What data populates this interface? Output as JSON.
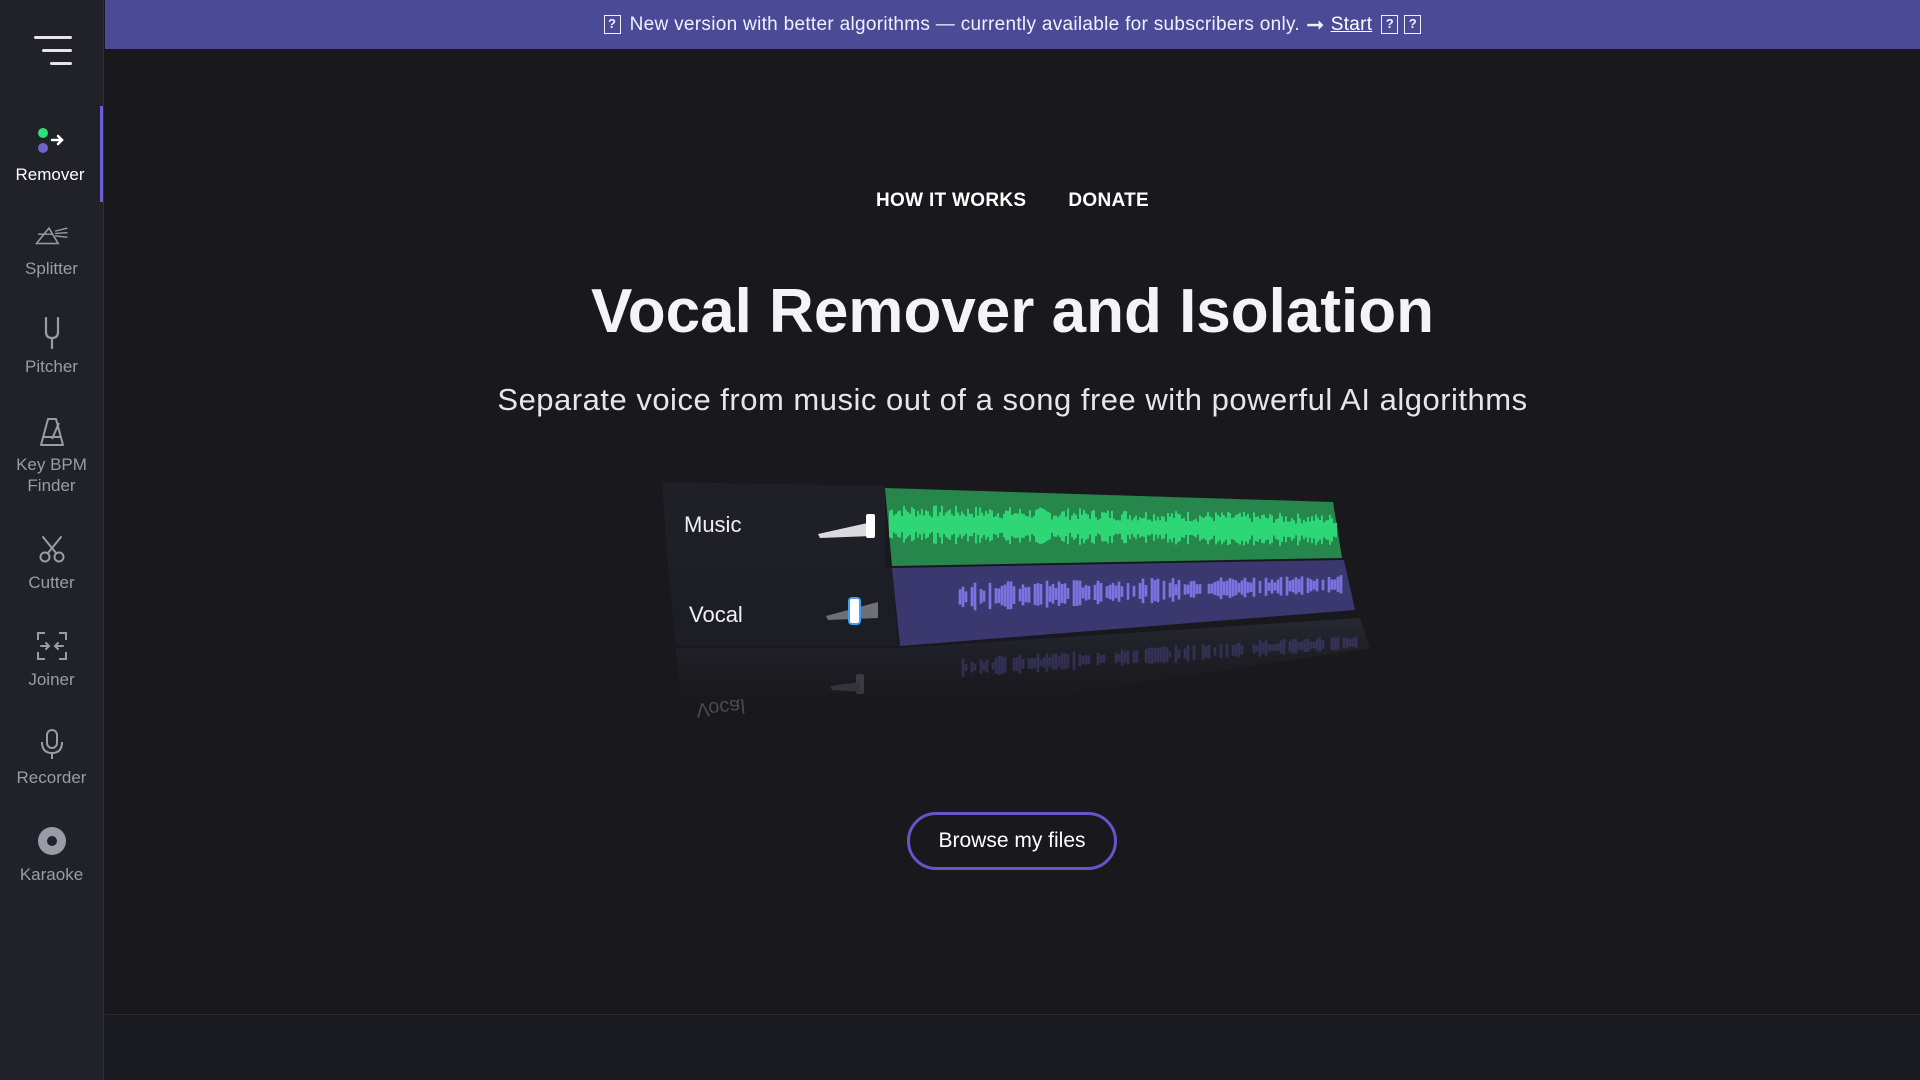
{
  "sidebar": {
    "items": [
      {
        "label": "Remover",
        "icon": "remover-icon",
        "active": true
      },
      {
        "label": "Splitter",
        "icon": "splitter-icon"
      },
      {
        "label": "Pitcher",
        "icon": "tuning-fork-icon"
      },
      {
        "label": "Key BPM Finder",
        "icon": "metronome-icon"
      },
      {
        "label": "Cutter",
        "icon": "scissors-icon"
      },
      {
        "label": "Joiner",
        "icon": "joiner-icon"
      },
      {
        "label": "Recorder",
        "icon": "microphone-icon"
      },
      {
        "label": "Karaoke",
        "icon": "karaoke-disc-icon"
      }
    ]
  },
  "banner": {
    "text": "New version with better algorithms — currently available for subscribers only.",
    "link": "Start",
    "icons": [
      "unknown-glyph-icon",
      "unknown-glyph-icon",
      "unknown-glyph-icon"
    ]
  },
  "nav": {
    "how_it_works": "HOW IT WORKS",
    "donate": "DONATE"
  },
  "hero": {
    "title": "Vocal Remover and Isolation",
    "subtitle": "Separate voice from music out of a song free with powerful AI algorithms"
  },
  "illustration": {
    "tracks": [
      {
        "name": "Music",
        "color": "#2fe07a"
      },
      {
        "name": "Vocal",
        "color": "#6e63c8"
      }
    ],
    "reflection_label": "Vocal"
  },
  "cta": {
    "browse_label": "Browse my files"
  },
  "colors": {
    "accent": "#6655c9",
    "banner": "#4b4a97",
    "background": "#18181d",
    "sidebar": "#212229",
    "music_green": "#2fe07a"
  }
}
